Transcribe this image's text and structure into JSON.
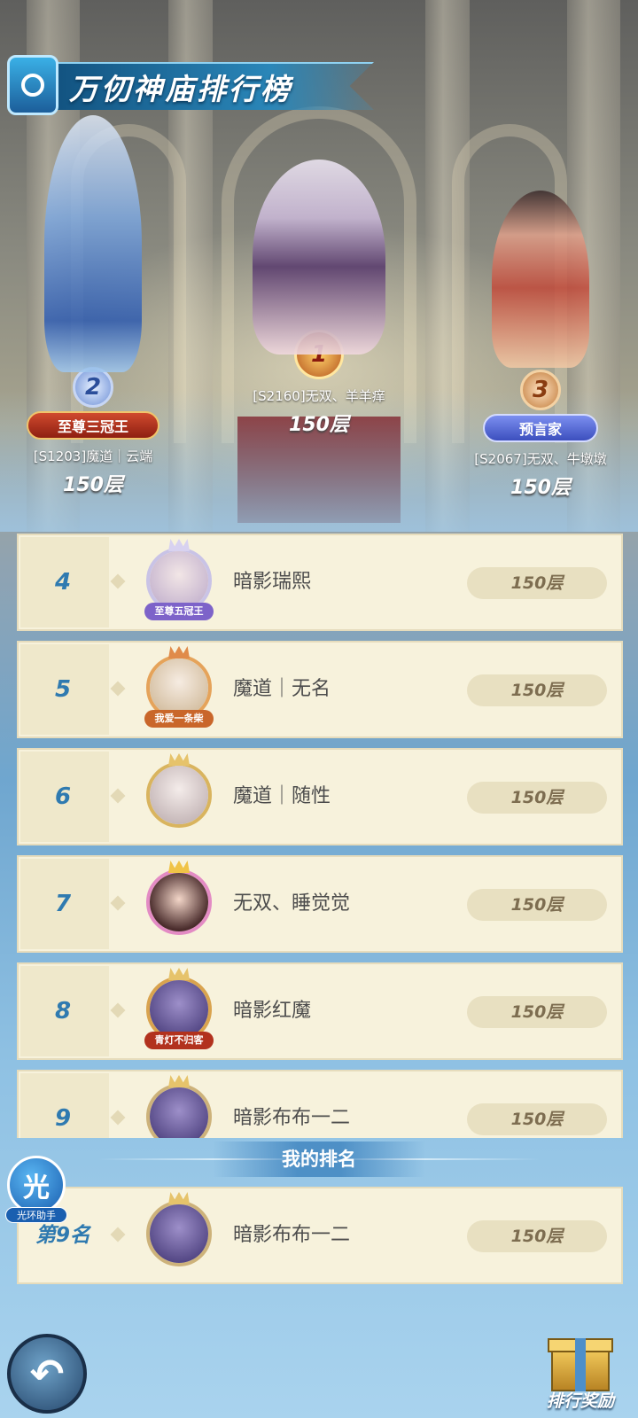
{
  "header": {
    "title": "万仞神庙排行榜"
  },
  "podium": [
    {
      "rank": "1",
      "name": "[S2160]无双、羊羊痒",
      "floor": "150层",
      "badge": ""
    },
    {
      "rank": "2",
      "name": "[S1203]魔道｜云端",
      "floor": "150层",
      "badge": "至尊三冠王"
    },
    {
      "rank": "3",
      "name": "[S2067]无双、牛墩墩",
      "floor": "150层",
      "badge": "预言家"
    }
  ],
  "ranking": [
    {
      "rank": "4",
      "name": "暗影瑞熙",
      "floor": "150层",
      "plate": "至尊五冠王"
    },
    {
      "rank": "5",
      "name": "魔道｜无名",
      "floor": "150层",
      "plate": "我爱一条柴"
    },
    {
      "rank": "6",
      "name": "魔道｜随性",
      "floor": "150层",
      "plate": ""
    },
    {
      "rank": "7",
      "name": "无双、睡觉觉",
      "floor": "150层",
      "plate": ""
    },
    {
      "rank": "8",
      "name": "暗影红魔",
      "floor": "150层",
      "plate": "青灯不归客"
    },
    {
      "rank": "9",
      "name": "暗影布布一二",
      "floor": "150层",
      "plate": ""
    }
  ],
  "my_rank": {
    "header": "我的排名",
    "rank": "第9名",
    "name": "暗影布布一二",
    "floor": "150层"
  },
  "helper": {
    "glyph": "光",
    "label": "光环助手"
  },
  "buttons": {
    "reward_label": "排行奖励",
    "back_icon": "back-arrow-icon"
  },
  "colors": {
    "rank_number": "#2f7ab0",
    "row_bg": "#f7f2dc",
    "pill_bg": "#e8e0c1",
    "title_ribbon": "#1d6fa3"
  }
}
